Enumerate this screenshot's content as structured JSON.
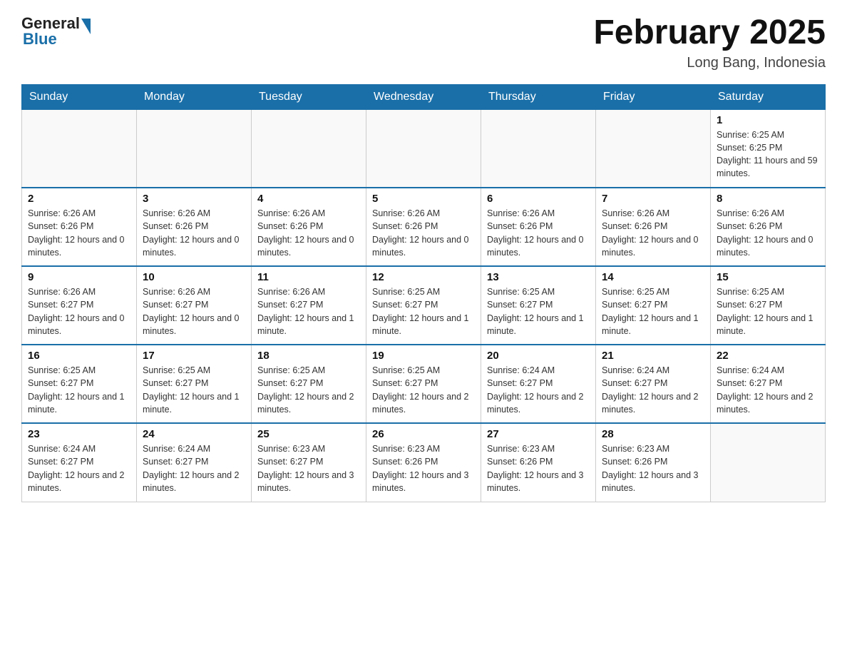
{
  "header": {
    "logo_general": "General",
    "logo_blue": "Blue",
    "month_title": "February 2025",
    "location": "Long Bang, Indonesia"
  },
  "days_of_week": [
    "Sunday",
    "Monday",
    "Tuesday",
    "Wednesday",
    "Thursday",
    "Friday",
    "Saturday"
  ],
  "weeks": [
    [
      {
        "day": "",
        "info": ""
      },
      {
        "day": "",
        "info": ""
      },
      {
        "day": "",
        "info": ""
      },
      {
        "day": "",
        "info": ""
      },
      {
        "day": "",
        "info": ""
      },
      {
        "day": "",
        "info": ""
      },
      {
        "day": "1",
        "info": "Sunrise: 6:25 AM\nSunset: 6:25 PM\nDaylight: 11 hours and 59 minutes."
      }
    ],
    [
      {
        "day": "2",
        "info": "Sunrise: 6:26 AM\nSunset: 6:26 PM\nDaylight: 12 hours and 0 minutes."
      },
      {
        "day": "3",
        "info": "Sunrise: 6:26 AM\nSunset: 6:26 PM\nDaylight: 12 hours and 0 minutes."
      },
      {
        "day": "4",
        "info": "Sunrise: 6:26 AM\nSunset: 6:26 PM\nDaylight: 12 hours and 0 minutes."
      },
      {
        "day": "5",
        "info": "Sunrise: 6:26 AM\nSunset: 6:26 PM\nDaylight: 12 hours and 0 minutes."
      },
      {
        "day": "6",
        "info": "Sunrise: 6:26 AM\nSunset: 6:26 PM\nDaylight: 12 hours and 0 minutes."
      },
      {
        "day": "7",
        "info": "Sunrise: 6:26 AM\nSunset: 6:26 PM\nDaylight: 12 hours and 0 minutes."
      },
      {
        "day": "8",
        "info": "Sunrise: 6:26 AM\nSunset: 6:26 PM\nDaylight: 12 hours and 0 minutes."
      }
    ],
    [
      {
        "day": "9",
        "info": "Sunrise: 6:26 AM\nSunset: 6:27 PM\nDaylight: 12 hours and 0 minutes."
      },
      {
        "day": "10",
        "info": "Sunrise: 6:26 AM\nSunset: 6:27 PM\nDaylight: 12 hours and 0 minutes."
      },
      {
        "day": "11",
        "info": "Sunrise: 6:26 AM\nSunset: 6:27 PM\nDaylight: 12 hours and 1 minute."
      },
      {
        "day": "12",
        "info": "Sunrise: 6:25 AM\nSunset: 6:27 PM\nDaylight: 12 hours and 1 minute."
      },
      {
        "day": "13",
        "info": "Sunrise: 6:25 AM\nSunset: 6:27 PM\nDaylight: 12 hours and 1 minute."
      },
      {
        "day": "14",
        "info": "Sunrise: 6:25 AM\nSunset: 6:27 PM\nDaylight: 12 hours and 1 minute."
      },
      {
        "day": "15",
        "info": "Sunrise: 6:25 AM\nSunset: 6:27 PM\nDaylight: 12 hours and 1 minute."
      }
    ],
    [
      {
        "day": "16",
        "info": "Sunrise: 6:25 AM\nSunset: 6:27 PM\nDaylight: 12 hours and 1 minute."
      },
      {
        "day": "17",
        "info": "Sunrise: 6:25 AM\nSunset: 6:27 PM\nDaylight: 12 hours and 1 minute."
      },
      {
        "day": "18",
        "info": "Sunrise: 6:25 AM\nSunset: 6:27 PM\nDaylight: 12 hours and 2 minutes."
      },
      {
        "day": "19",
        "info": "Sunrise: 6:25 AM\nSunset: 6:27 PM\nDaylight: 12 hours and 2 minutes."
      },
      {
        "day": "20",
        "info": "Sunrise: 6:24 AM\nSunset: 6:27 PM\nDaylight: 12 hours and 2 minutes."
      },
      {
        "day": "21",
        "info": "Sunrise: 6:24 AM\nSunset: 6:27 PM\nDaylight: 12 hours and 2 minutes."
      },
      {
        "day": "22",
        "info": "Sunrise: 6:24 AM\nSunset: 6:27 PM\nDaylight: 12 hours and 2 minutes."
      }
    ],
    [
      {
        "day": "23",
        "info": "Sunrise: 6:24 AM\nSunset: 6:27 PM\nDaylight: 12 hours and 2 minutes."
      },
      {
        "day": "24",
        "info": "Sunrise: 6:24 AM\nSunset: 6:27 PM\nDaylight: 12 hours and 2 minutes."
      },
      {
        "day": "25",
        "info": "Sunrise: 6:23 AM\nSunset: 6:27 PM\nDaylight: 12 hours and 3 minutes."
      },
      {
        "day": "26",
        "info": "Sunrise: 6:23 AM\nSunset: 6:26 PM\nDaylight: 12 hours and 3 minutes."
      },
      {
        "day": "27",
        "info": "Sunrise: 6:23 AM\nSunset: 6:26 PM\nDaylight: 12 hours and 3 minutes."
      },
      {
        "day": "28",
        "info": "Sunrise: 6:23 AM\nSunset: 6:26 PM\nDaylight: 12 hours and 3 minutes."
      },
      {
        "day": "",
        "info": ""
      }
    ]
  ]
}
